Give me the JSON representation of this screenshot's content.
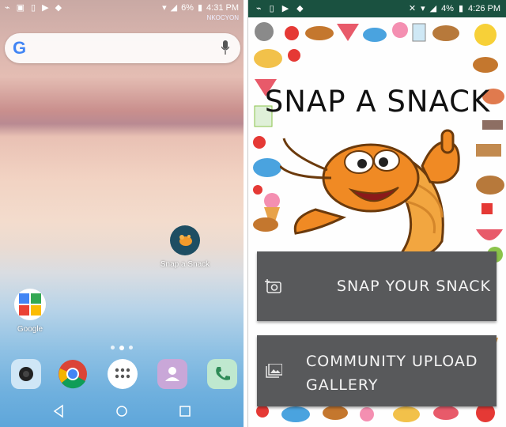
{
  "left_screen": {
    "status_bar": {
      "battery": "6%",
      "time": "4:31 PM",
      "carrier": "NKOCYON",
      "icons": [
        "usb-icon",
        "image-icon",
        "sim-icon",
        "play-icon",
        "android-icon",
        "wifi-icon",
        "signal-icon",
        "battery-icon"
      ]
    },
    "search_widget": {
      "logo": "G",
      "icons": [
        "google-logo-icon",
        "mic-icon"
      ]
    },
    "apps": [
      {
        "label": "Snap a Snack",
        "icon": "shrimp-app-icon"
      },
      {
        "label": "Google",
        "icon": "google-folder-icon"
      }
    ],
    "dock": [
      "camera-app-icon",
      "chrome-icon",
      "app-drawer-icon",
      "contacts-icon",
      "phone-icon"
    ],
    "nav": [
      "back-icon",
      "home-icon",
      "recents-icon"
    ]
  },
  "right_screen": {
    "status_bar": {
      "battery": "4%",
      "time": "4:26 PM",
      "color": "#1a5140",
      "icons": [
        "usb-icon",
        "sim-icon",
        "play-icon",
        "android-icon",
        "mute-icon",
        "wifi-icon",
        "signal-icon",
        "battery-icon"
      ]
    },
    "title": "SNAP A SNACK",
    "buttons": {
      "snap": {
        "label": "SNAP YOUR SNACK",
        "icon": "add-camera-icon"
      },
      "gallery": {
        "line1": "COMMUNITY UPLOAD",
        "line2": "GALLERY",
        "icon": "image-gallery-icon"
      }
    },
    "colors": {
      "button_bg": "#58595b",
      "button_text": "#f4f4f4"
    }
  }
}
